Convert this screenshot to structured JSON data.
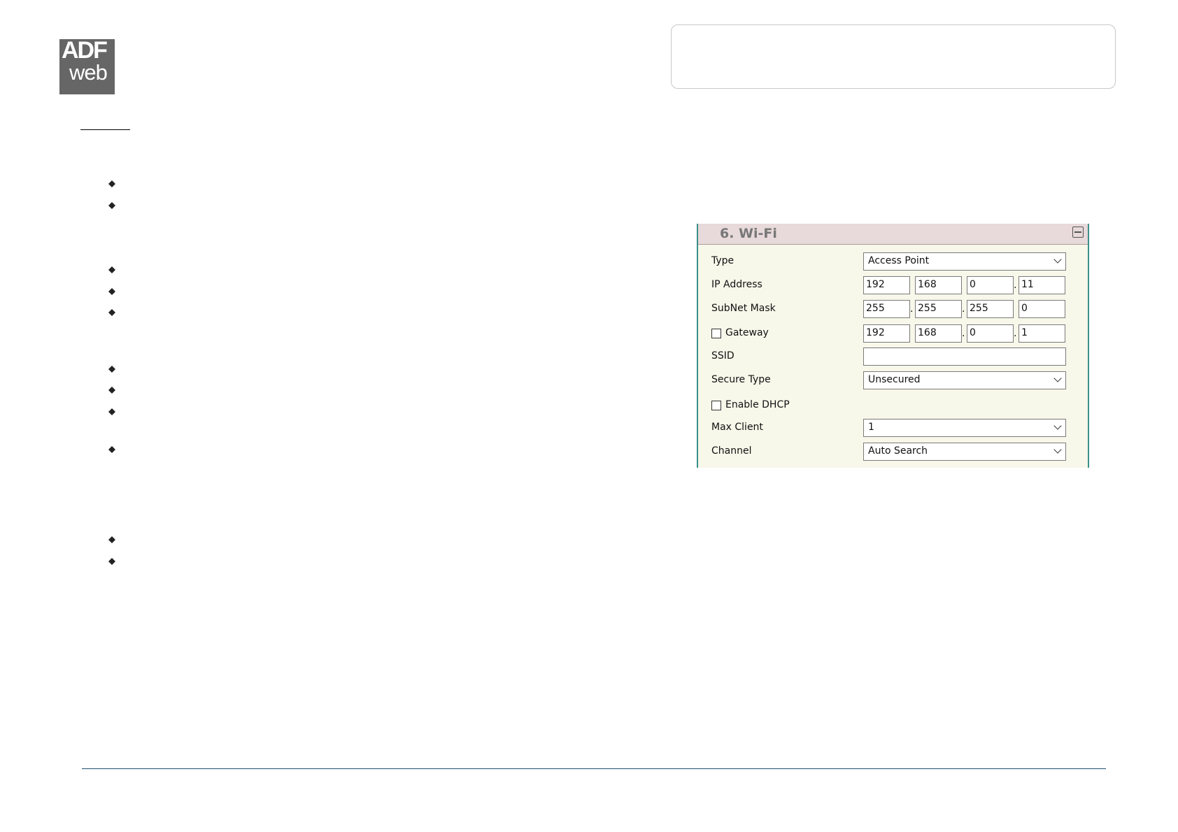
{
  "logo": {
    "line1": "ADF",
    "line2": "web"
  },
  "wifi_panel": {
    "title": "6. Wi-Fi",
    "type": {
      "label": "Type",
      "value": "Access Point"
    },
    "ip_address": {
      "label": "IP Address",
      "octets": [
        "192",
        "168",
        "0",
        "11"
      ]
    },
    "subnet_mask": {
      "label": "SubNet Mask",
      "octets": [
        "255",
        "255",
        "255",
        "0"
      ]
    },
    "gateway": {
      "label": "Gateway",
      "checked": false,
      "octets": [
        "192",
        "168",
        "0",
        "1"
      ]
    },
    "ssid": {
      "label": "SSID",
      "value": ""
    },
    "secure_type": {
      "label": "Secure Type",
      "value": "Unsecured"
    },
    "enable_dhcp": {
      "label": "Enable DHCP",
      "checked": false
    },
    "max_client": {
      "label": "Max Client",
      "value": "1"
    },
    "channel": {
      "label": "Channel",
      "value": "Auto Search"
    },
    "separator": "."
  },
  "colors": {
    "panel_border": "#3a8f8a",
    "panel_header": "#e8d9da",
    "panel_bg": "#f7f7ea",
    "footer_rule": "#1f4e6e",
    "logo_bg": "#666666"
  },
  "icons": {
    "bullet": "diamond-bullet-icon",
    "collapse": "collapse-icon",
    "dropdown": "chevron-down-icon"
  }
}
